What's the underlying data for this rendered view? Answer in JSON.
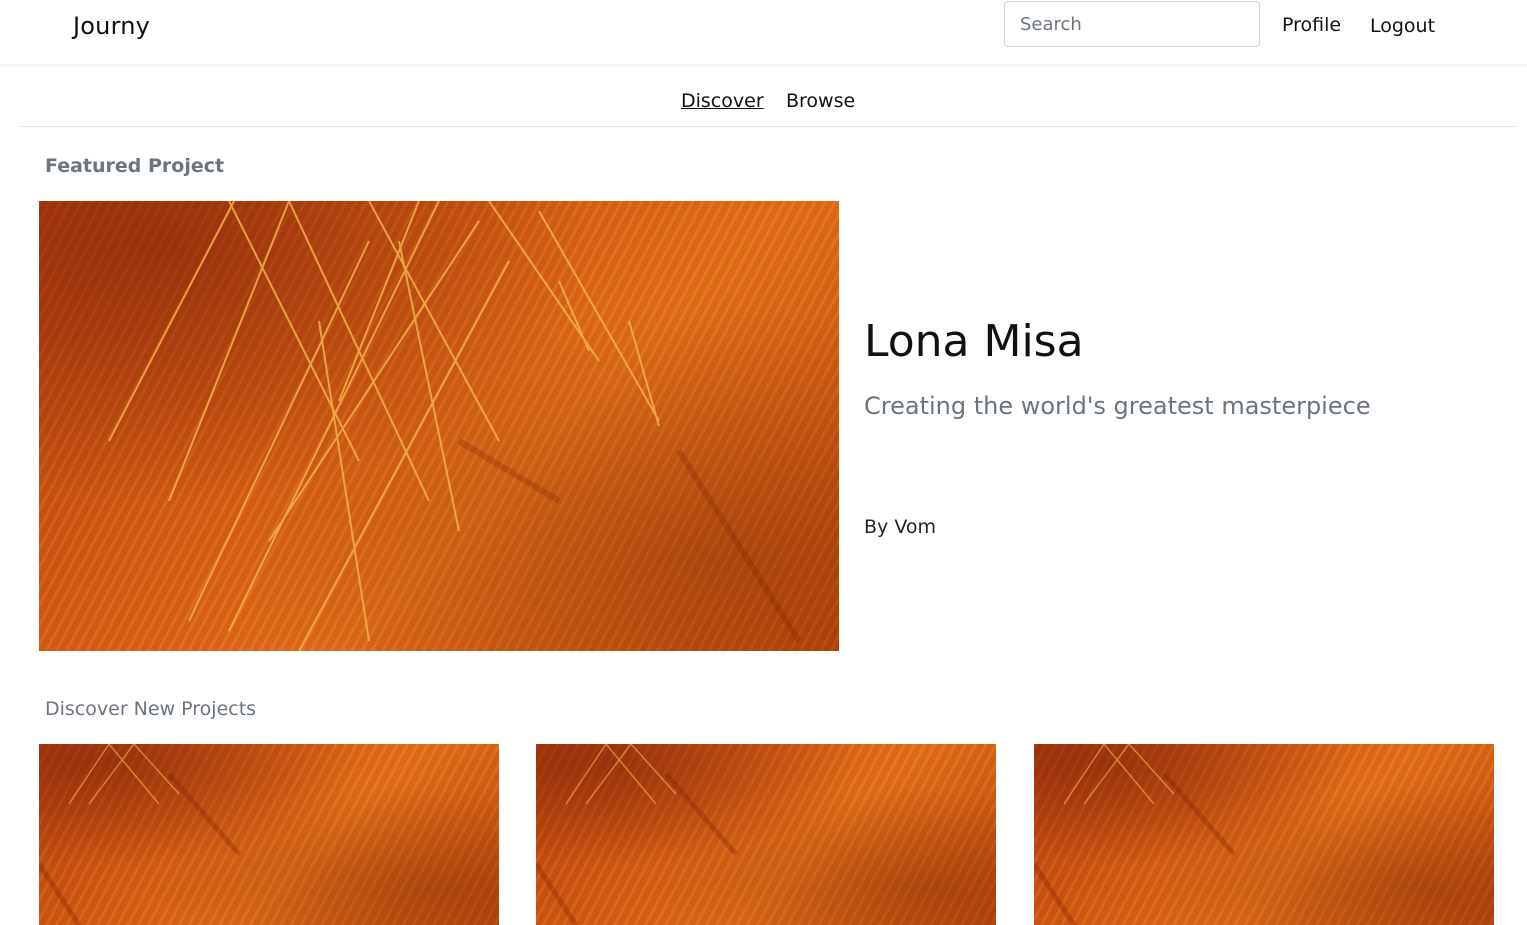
{
  "header": {
    "brand": "Journy",
    "search_placeholder": "Search",
    "profile_label": "Profile",
    "logout_label": "Logout"
  },
  "subnav": {
    "tabs": [
      {
        "label": "Discover",
        "active": true
      },
      {
        "label": "Browse",
        "active": false
      }
    ]
  },
  "featured": {
    "section_title": "Featured Project",
    "title": "Lona Misa",
    "subtitle": "Creating the world's greatest masterpiece",
    "author": "By Vom"
  },
  "discover": {
    "section_title": "Discover New Projects",
    "project_count": 3
  },
  "colors": {
    "accent_orange": "#d45b14",
    "muted_text": "#6c757d"
  }
}
